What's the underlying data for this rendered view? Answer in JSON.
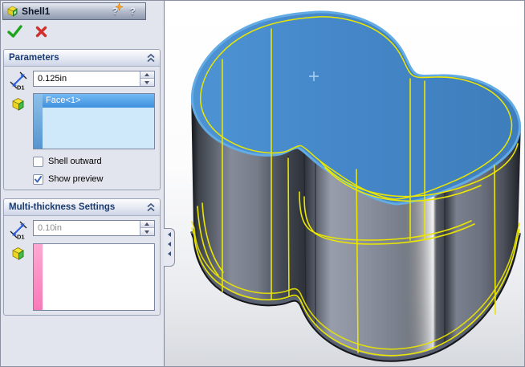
{
  "panel": {
    "title": "Shell1",
    "help_pin_label": "?",
    "help_label": "?",
    "ok_tooltip": "OK",
    "cancel_tooltip": "Cancel",
    "groups": [
      {
        "header": "Parameters",
        "d1_label": "D1",
        "thickness_value": "0.125in",
        "selection_items": [
          "Face<1>"
        ],
        "selection_stripe_color": "#5e9fd8",
        "checkboxes": [
          {
            "label": "Shell outward",
            "checked": false
          },
          {
            "label": "Show preview",
            "checked": true
          }
        ]
      },
      {
        "header": "Multi-thickness Settings",
        "d1_label": "D1",
        "thickness_value": "0.10in",
        "selection_items": [],
        "selection_stripe_color": "#fb8cc3"
      }
    ]
  },
  "viewport": {
    "selected_face": "Face<1>",
    "preview_type": "shell-outline-preview",
    "colors": {
      "selected_face_fill": "#4186c6",
      "selected_edge_highlight": "#63abe4",
      "preview_edge_yellow": "#eae600",
      "wall_gray": "#6b7078",
      "background_top": "#ffffff",
      "background_bottom": "#d6d9de"
    }
  }
}
